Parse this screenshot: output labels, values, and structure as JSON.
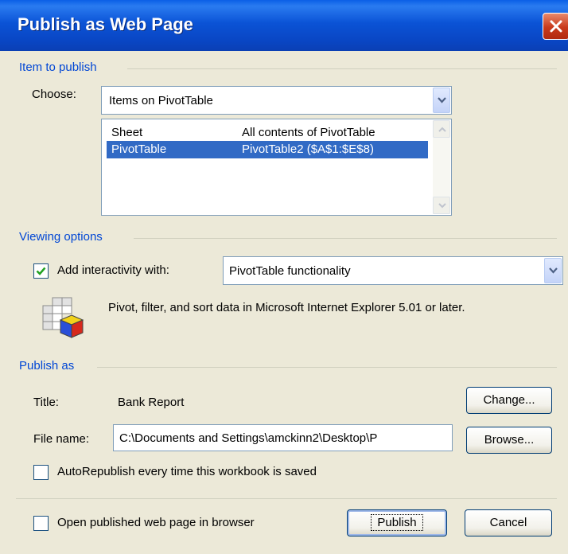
{
  "window": {
    "title": "Publish as Web Page"
  },
  "item_to_publish": {
    "section_label": "Item to publish",
    "choose_label": "Choose:",
    "choose_value": "Items on PivotTable",
    "list": [
      {
        "name": "Sheet",
        "description": "All contents of PivotTable",
        "selected": false
      },
      {
        "name": "PivotTable",
        "description": "PivotTable2 ($A$1:$E$8)",
        "selected": true
      }
    ]
  },
  "viewing_options": {
    "section_label": "Viewing options",
    "interactivity_label": "Add interactivity with:",
    "interactivity_checked": true,
    "interactivity_value": "PivotTable functionality",
    "description": "Pivot, filter, and sort data in Microsoft Internet Explorer 5.01 or later."
  },
  "publish_as": {
    "section_label": "Publish as",
    "title_label": "Title:",
    "title_value": "Bank Report",
    "change_button": "Change...",
    "file_name_label": "File name:",
    "file_name_value": "C:\\Documents and Settings\\amckinn2\\Desktop\\P",
    "browse_button": "Browse...",
    "autorepublish_label": "AutoRepublish every time this workbook is saved",
    "autorepublish_checked": false
  },
  "footer": {
    "open_in_browser_label": "Open published web page in browser",
    "open_in_browser_checked": false,
    "publish_button": "Publish",
    "cancel_button": "Cancel"
  },
  "colors": {
    "accent": "#0046D5",
    "selection": "#316AC5",
    "titlebar": "#0A53D6",
    "face": "#ECE9D8"
  }
}
